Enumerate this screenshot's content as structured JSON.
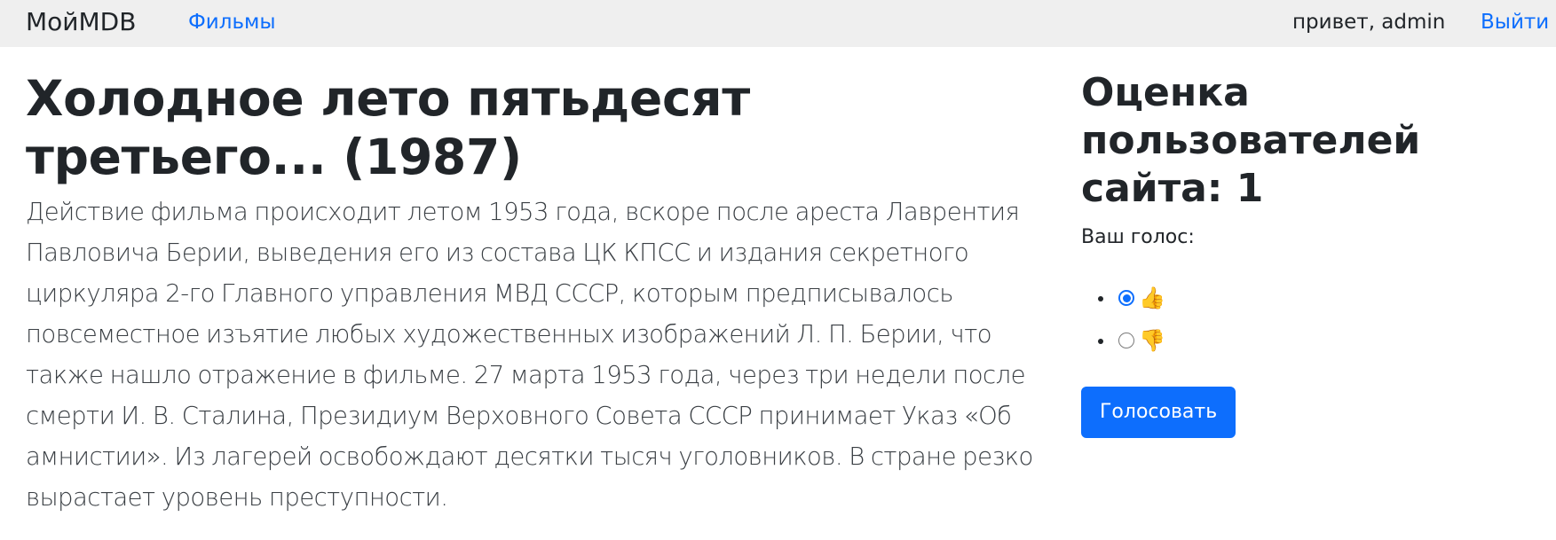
{
  "navbar": {
    "brand": "МойMDB",
    "films_link": "Фильмы",
    "greeting": "привет, admin",
    "logout_link": "Выйти"
  },
  "movie": {
    "title": "Холодное лето пятьдесят третьего... (1987)",
    "description": "Действие фильма происходит летом 1953 года, вскоре после ареста Лаврентия Павловича Берии, выведения его из состава ЦК КПСС и издания секретного циркуляра 2-го Главного управления МВД СССР, которым предписывалось повсеместное изъятие любых художественных изображений Л. П. Берии, что также нашло отражение в фильме. 27 марта 1953 года, через три недели после смерти И. В. Сталина, Президиум Верховного Совета СССР принимает Указ «Об амнистии». Из лагерей освобождают десятки тысяч уголовников. В стране резко вырастает уровень преступности."
  },
  "rating": {
    "title": "Оценка пользователей сайта: 1",
    "vote_label": "Ваш голос:",
    "options": [
      {
        "icon": "thumbs-up-icon",
        "glyph": "👍",
        "selected": true
      },
      {
        "icon": "thumbs-down-icon",
        "glyph": "👎",
        "selected": false
      }
    ],
    "submit_label": "Голосовать"
  },
  "colors": {
    "navbar_bg": "#efefef",
    "link": "#0d6efd",
    "button_bg": "#0d6efd",
    "text": "#212529"
  }
}
